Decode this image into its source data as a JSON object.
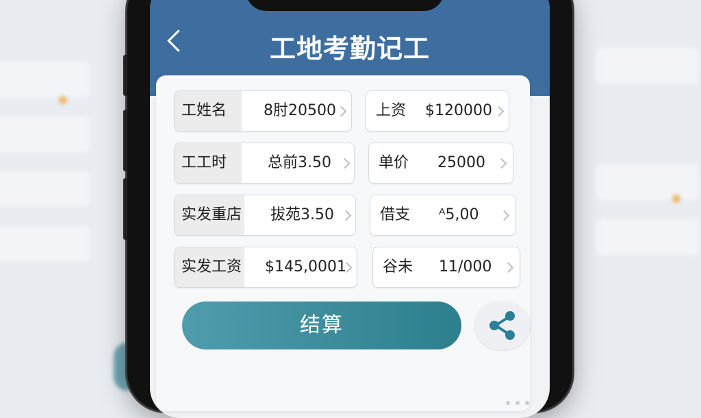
{
  "header": {
    "title": "工地考勤记工"
  },
  "fields_left": [
    {
      "label": "工姓名",
      "value": "8肘20500"
    },
    {
      "label": "工工时",
      "value": "总前3.50"
    },
    {
      "label": "实发重店",
      "value": "拔苑3.50"
    },
    {
      "label": "实发工资",
      "value": "$145,0001"
    }
  ],
  "fields_right": [
    {
      "label": "上资",
      "value": "$120000"
    },
    {
      "label": "单价",
      "value": "25000"
    },
    {
      "label": "借支",
      "value": "ᴬ5,00"
    },
    {
      "label": "谷未",
      "value": "11/000"
    }
  ],
  "actions": {
    "calculate_label": "结算"
  },
  "colors": {
    "header": "#3d6e9f",
    "button": "#3a8b9b",
    "icon": "#2b7f96"
  },
  "icons": [
    "back-icon",
    "share-icon",
    "chevron-right-icon"
  ]
}
